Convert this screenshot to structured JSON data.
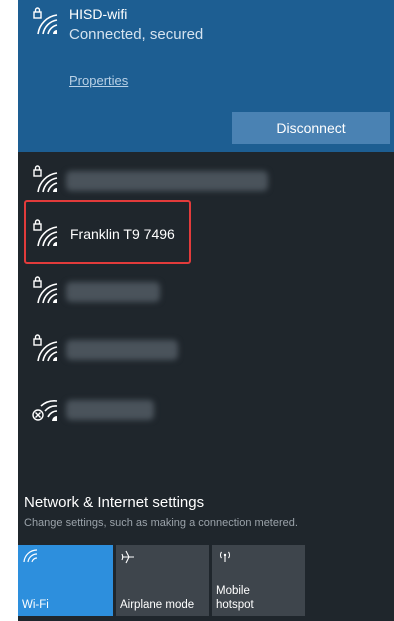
{
  "connected": {
    "name": "HISD-wifi",
    "status": "Connected, secured",
    "properties_label": "Properties",
    "disconnect_label": "Disconnect"
  },
  "networks": [
    {
      "label": "",
      "hidden": true,
      "icon": "wifi-secured-icon"
    },
    {
      "label": "Franklin T9 7496",
      "hidden": false,
      "icon": "wifi-secured-icon"
    },
    {
      "label": "",
      "hidden": true,
      "icon": "wifi-secured-icon"
    },
    {
      "label": "",
      "hidden": true,
      "icon": "wifi-secured-icon"
    },
    {
      "label": "",
      "hidden": true,
      "icon": "wifi-unavailable-icon"
    }
  ],
  "settings": {
    "title": "Network & Internet settings",
    "description": "Change settings, such as making a connection metered."
  },
  "quick_actions": [
    {
      "label": "Wi-Fi",
      "icon": "wifi-icon",
      "active": true
    },
    {
      "label": "Airplane mode",
      "icon": "airplane-icon",
      "active": false
    },
    {
      "label_line1": "Mobile",
      "label_line2": "hotspot",
      "icon": "mobile-hotspot-icon",
      "active": false
    }
  ],
  "colors": {
    "flyout_bg": "#1f262c",
    "connected_bg": "#1d5e92",
    "accent": "#2d8fdd",
    "highlight": "#e23b3b"
  }
}
